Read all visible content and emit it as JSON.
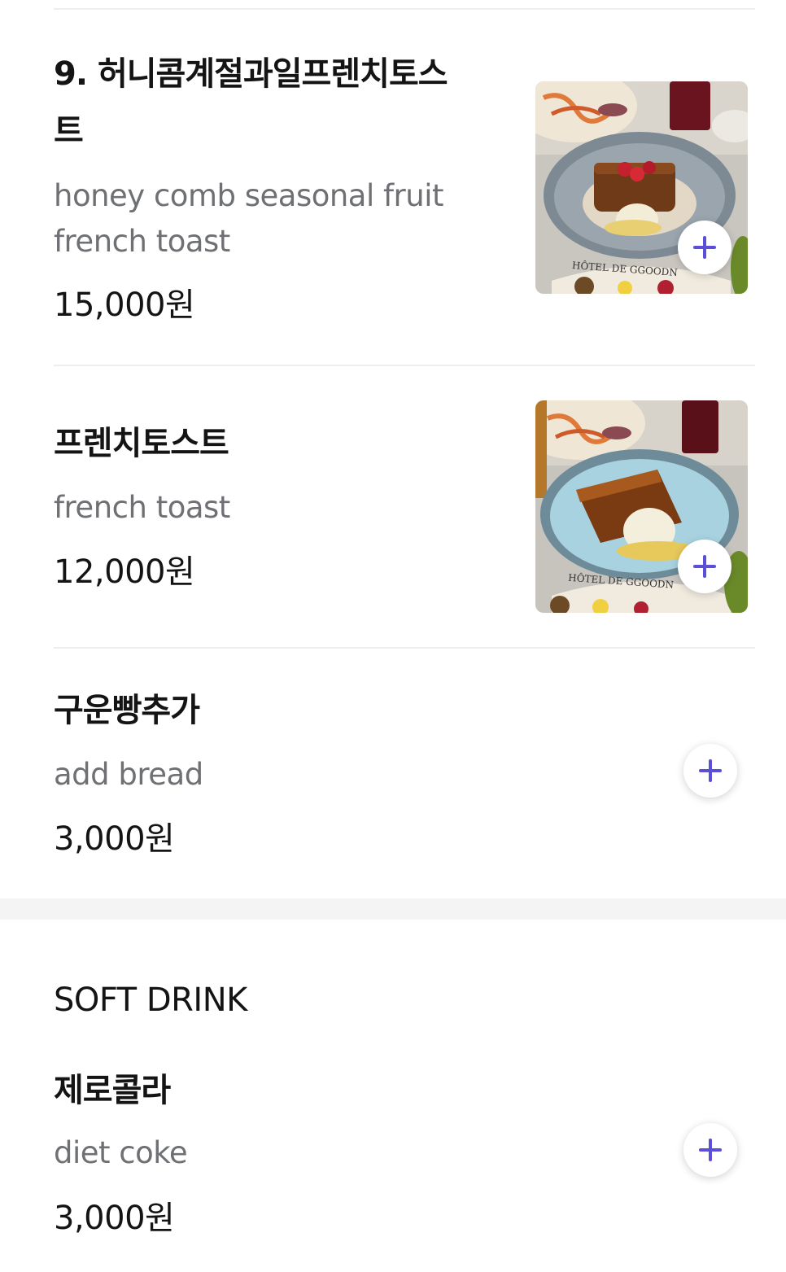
{
  "menu_items": [
    {
      "name": "9. 허니콤계절과일프렌치토스트",
      "name_line1": "9. 허니콤계절과일프렌치토스",
      "name_line2": "트",
      "description": "honey comb seasonal fruit french toast",
      "description_line1": "honey comb seasonal fruit",
      "description_line2": "french toast",
      "price": "15,000원",
      "photo_caption": "HÔTEL DE GGOODN",
      "has_photo": true,
      "plate_color": "#9aa5ad"
    },
    {
      "name": "프렌치토스트",
      "description": "french toast",
      "price": "12,000원",
      "photo_caption": "HÔTEL DE GGOODN",
      "has_photo": true,
      "plate_color": "#a9d2e0"
    },
    {
      "name": "구운빵추가",
      "description": "add bread",
      "price": "3,000원",
      "has_photo": false
    }
  ],
  "sections": [
    {
      "title": "SOFT DRINK",
      "items": [
        {
          "name": "제로콜라",
          "description": "diet coke",
          "price": "3,000원",
          "has_photo": false
        }
      ]
    }
  ],
  "colors": {
    "accent": "#5a4fd6",
    "text_primary": "#141414",
    "text_secondary": "#6e7074",
    "divider": "#eeeeee",
    "section_gap": "#f4f4f4"
  },
  "icons": {
    "add": "plus-icon"
  }
}
